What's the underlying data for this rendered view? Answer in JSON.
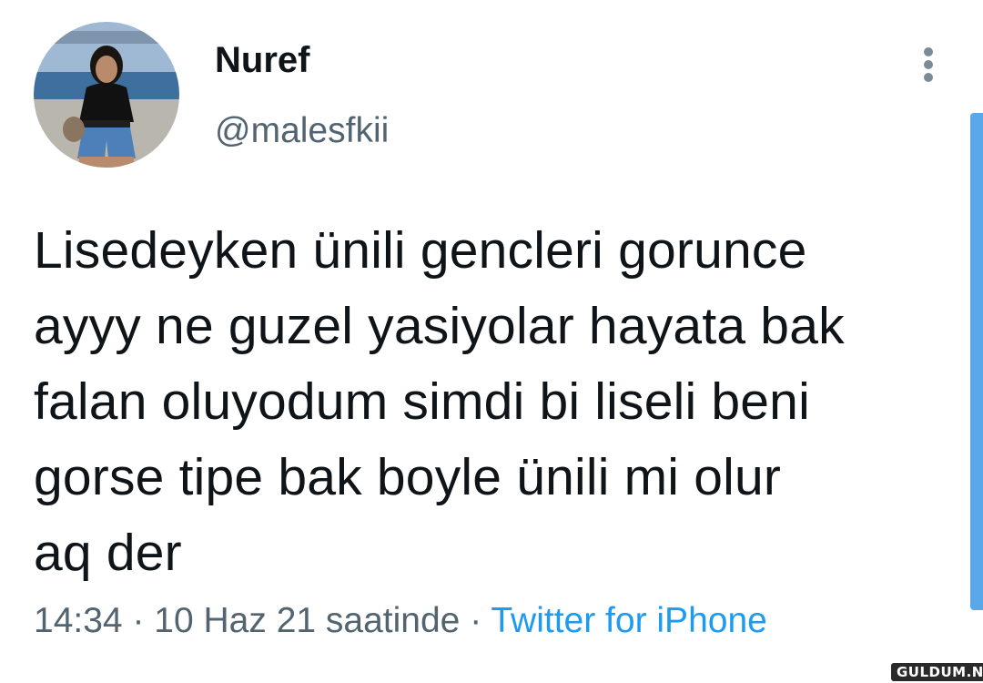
{
  "user": {
    "display_name": "Nuref",
    "handle": "@malesfkii"
  },
  "tweet": {
    "text": "Lisedeyken ünili gencleri gorunce\nayyy ne guzel yasiyolar hayata bak\nfalan oluyodum simdi bi liseli beni\ngorse tipe bak boyle ünili mi olur\naq der",
    "time": "14:34",
    "separator": "·",
    "date": "10 Haz 21 saatinde",
    "source": "Twitter for iPhone"
  },
  "watermark": "GULDUM.NET",
  "icons": {
    "more": "more-vertical-icon"
  },
  "colors": {
    "text": "#0f1419",
    "secondary": "#536471",
    "link": "#1d9bf0",
    "scrollbar": "#5aa8ea"
  }
}
